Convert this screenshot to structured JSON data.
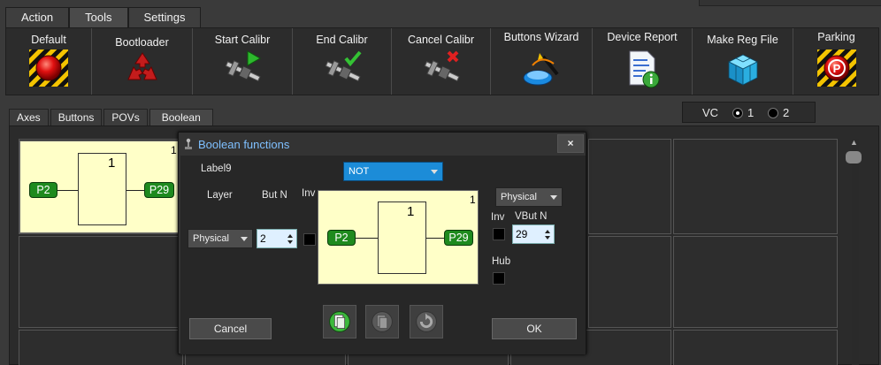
{
  "top_tabs": [
    "Action",
    "Tools",
    "Settings"
  ],
  "active_top_tab": "Tools",
  "toolbar": {
    "tools": [
      {
        "label": "Default",
        "icon": "red-button-icon"
      },
      {
        "label": "Bootloader",
        "icon": "recycle-icon"
      },
      {
        "label": "Start Calibr",
        "icon": "caliper-play-icon"
      },
      {
        "label": "End Calibr",
        "icon": "caliper-check-icon"
      },
      {
        "label": "Cancel Calibr",
        "icon": "caliper-cancel-icon"
      },
      {
        "label": "Buttons Wizard",
        "icon": "wizard-icon"
      },
      {
        "label": "Device Report",
        "icon": "report-info-icon"
      },
      {
        "label": "Make Reg File",
        "icon": "registry-cube-icon"
      },
      {
        "label": "Parking",
        "icon": "parking-icon"
      }
    ]
  },
  "sub_tabs": [
    "Axes",
    "Buttons",
    "POVs",
    "Boolean"
  ],
  "active_sub_tab": "Boolean",
  "vc": {
    "label": "VC",
    "options": [
      "1",
      "2"
    ],
    "selected": "1"
  },
  "grid_block": {
    "corner": "1",
    "gate": "1",
    "input": "P2",
    "output": "P29"
  },
  "dialog": {
    "title": "Boolean functions",
    "close": "×",
    "label9": "Label9",
    "function_select": "NOT",
    "layer_label": "Layer",
    "butn_label": "But N",
    "inv_label": "Inv",
    "layer_select": "Physical",
    "butn_value": "2",
    "preview": {
      "corner": "1",
      "gate": "1",
      "input": "P2",
      "output": "P29"
    },
    "out_layer_select": "Physical",
    "out_inv_label": "Inv",
    "vbutn_label": "VBut N",
    "vbutn_value": "29",
    "hub_label": "Hub",
    "cancel": "Cancel",
    "ok": "OK"
  },
  "colors": {
    "accent_blue": "#1c8cd8",
    "pin_green": "#1e8a1e",
    "block_yellow": "#ffffc8",
    "title_blue": "#7fc0ff"
  }
}
